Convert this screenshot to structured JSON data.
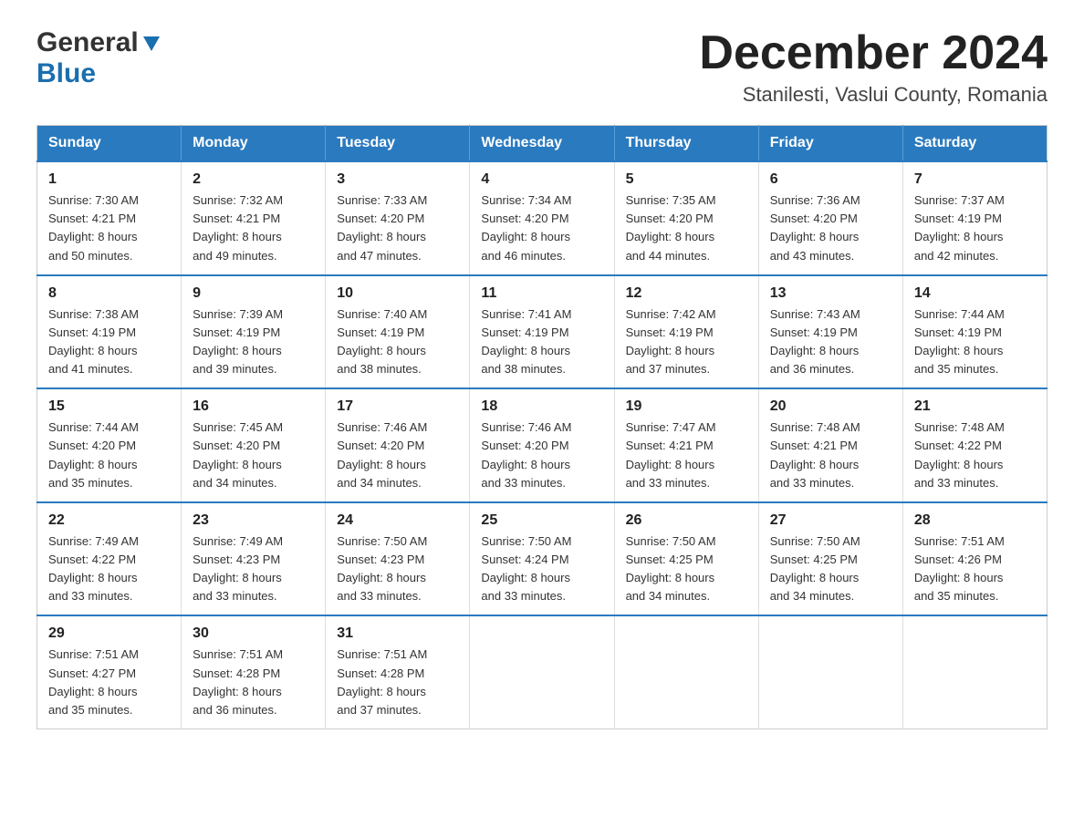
{
  "header": {
    "logo_general": "General",
    "logo_blue": "Blue",
    "month_title": "December 2024",
    "location": "Stanilesti, Vaslui County, Romania"
  },
  "calendar": {
    "days_of_week": [
      "Sunday",
      "Monday",
      "Tuesday",
      "Wednesday",
      "Thursday",
      "Friday",
      "Saturday"
    ],
    "weeks": [
      [
        {
          "day": "1",
          "info": "Sunrise: 7:30 AM\nSunset: 4:21 PM\nDaylight: 8 hours\nand 50 minutes."
        },
        {
          "day": "2",
          "info": "Sunrise: 7:32 AM\nSunset: 4:21 PM\nDaylight: 8 hours\nand 49 minutes."
        },
        {
          "day": "3",
          "info": "Sunrise: 7:33 AM\nSunset: 4:20 PM\nDaylight: 8 hours\nand 47 minutes."
        },
        {
          "day": "4",
          "info": "Sunrise: 7:34 AM\nSunset: 4:20 PM\nDaylight: 8 hours\nand 46 minutes."
        },
        {
          "day": "5",
          "info": "Sunrise: 7:35 AM\nSunset: 4:20 PM\nDaylight: 8 hours\nand 44 minutes."
        },
        {
          "day": "6",
          "info": "Sunrise: 7:36 AM\nSunset: 4:20 PM\nDaylight: 8 hours\nand 43 minutes."
        },
        {
          "day": "7",
          "info": "Sunrise: 7:37 AM\nSunset: 4:19 PM\nDaylight: 8 hours\nand 42 minutes."
        }
      ],
      [
        {
          "day": "8",
          "info": "Sunrise: 7:38 AM\nSunset: 4:19 PM\nDaylight: 8 hours\nand 41 minutes."
        },
        {
          "day": "9",
          "info": "Sunrise: 7:39 AM\nSunset: 4:19 PM\nDaylight: 8 hours\nand 39 minutes."
        },
        {
          "day": "10",
          "info": "Sunrise: 7:40 AM\nSunset: 4:19 PM\nDaylight: 8 hours\nand 38 minutes."
        },
        {
          "day": "11",
          "info": "Sunrise: 7:41 AM\nSunset: 4:19 PM\nDaylight: 8 hours\nand 38 minutes."
        },
        {
          "day": "12",
          "info": "Sunrise: 7:42 AM\nSunset: 4:19 PM\nDaylight: 8 hours\nand 37 minutes."
        },
        {
          "day": "13",
          "info": "Sunrise: 7:43 AM\nSunset: 4:19 PM\nDaylight: 8 hours\nand 36 minutes."
        },
        {
          "day": "14",
          "info": "Sunrise: 7:44 AM\nSunset: 4:19 PM\nDaylight: 8 hours\nand 35 minutes."
        }
      ],
      [
        {
          "day": "15",
          "info": "Sunrise: 7:44 AM\nSunset: 4:20 PM\nDaylight: 8 hours\nand 35 minutes."
        },
        {
          "day": "16",
          "info": "Sunrise: 7:45 AM\nSunset: 4:20 PM\nDaylight: 8 hours\nand 34 minutes."
        },
        {
          "day": "17",
          "info": "Sunrise: 7:46 AM\nSunset: 4:20 PM\nDaylight: 8 hours\nand 34 minutes."
        },
        {
          "day": "18",
          "info": "Sunrise: 7:46 AM\nSunset: 4:20 PM\nDaylight: 8 hours\nand 33 minutes."
        },
        {
          "day": "19",
          "info": "Sunrise: 7:47 AM\nSunset: 4:21 PM\nDaylight: 8 hours\nand 33 minutes."
        },
        {
          "day": "20",
          "info": "Sunrise: 7:48 AM\nSunset: 4:21 PM\nDaylight: 8 hours\nand 33 minutes."
        },
        {
          "day": "21",
          "info": "Sunrise: 7:48 AM\nSunset: 4:22 PM\nDaylight: 8 hours\nand 33 minutes."
        }
      ],
      [
        {
          "day": "22",
          "info": "Sunrise: 7:49 AM\nSunset: 4:22 PM\nDaylight: 8 hours\nand 33 minutes."
        },
        {
          "day": "23",
          "info": "Sunrise: 7:49 AM\nSunset: 4:23 PM\nDaylight: 8 hours\nand 33 minutes."
        },
        {
          "day": "24",
          "info": "Sunrise: 7:50 AM\nSunset: 4:23 PM\nDaylight: 8 hours\nand 33 minutes."
        },
        {
          "day": "25",
          "info": "Sunrise: 7:50 AM\nSunset: 4:24 PM\nDaylight: 8 hours\nand 33 minutes."
        },
        {
          "day": "26",
          "info": "Sunrise: 7:50 AM\nSunset: 4:25 PM\nDaylight: 8 hours\nand 34 minutes."
        },
        {
          "day": "27",
          "info": "Sunrise: 7:50 AM\nSunset: 4:25 PM\nDaylight: 8 hours\nand 34 minutes."
        },
        {
          "day": "28",
          "info": "Sunrise: 7:51 AM\nSunset: 4:26 PM\nDaylight: 8 hours\nand 35 minutes."
        }
      ],
      [
        {
          "day": "29",
          "info": "Sunrise: 7:51 AM\nSunset: 4:27 PM\nDaylight: 8 hours\nand 35 minutes."
        },
        {
          "day": "30",
          "info": "Sunrise: 7:51 AM\nSunset: 4:28 PM\nDaylight: 8 hours\nand 36 minutes."
        },
        {
          "day": "31",
          "info": "Sunrise: 7:51 AM\nSunset: 4:28 PM\nDaylight: 8 hours\nand 37 minutes."
        },
        {
          "day": "",
          "info": ""
        },
        {
          "day": "",
          "info": ""
        },
        {
          "day": "",
          "info": ""
        },
        {
          "day": "",
          "info": ""
        }
      ]
    ]
  }
}
